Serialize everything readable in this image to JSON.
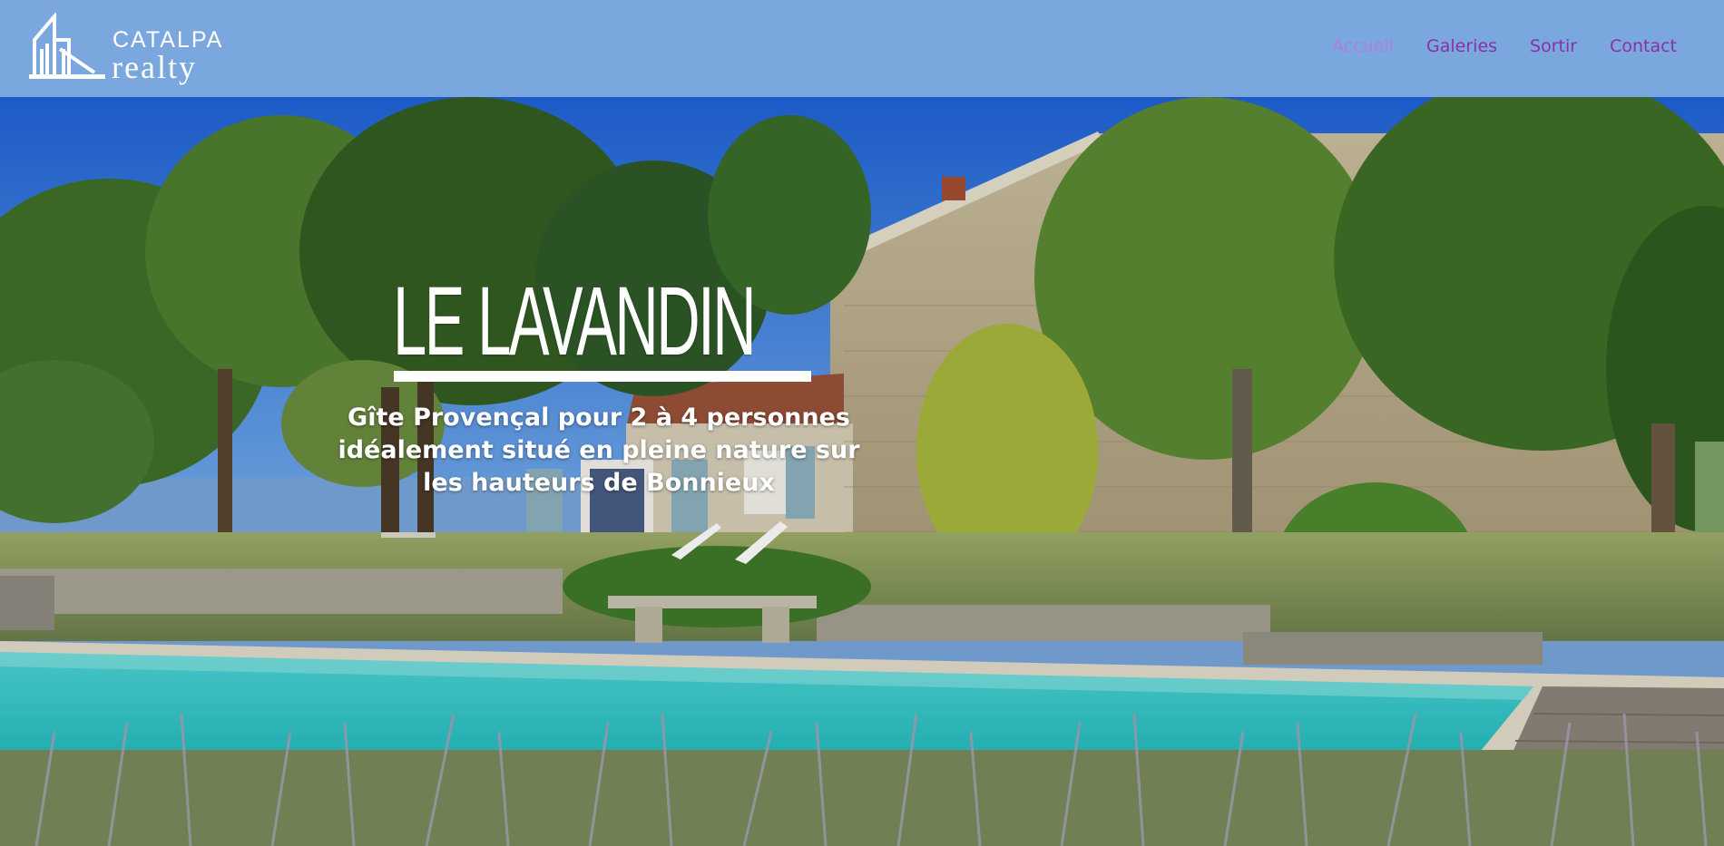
{
  "brand": {
    "name_top": "CATALPA",
    "name_bottom": "realty",
    "logo_icon": "building-outline-icon"
  },
  "nav": {
    "items": [
      {
        "label": "Accueil",
        "active": true
      },
      {
        "label": "Galeries",
        "active": false
      },
      {
        "label": "Sortir",
        "active": false
      },
      {
        "label": "Contact",
        "active": false
      }
    ]
  },
  "hero": {
    "title": "LE LAVANDIN",
    "subtitle": "Gîte Provençal pour 2 à 4 personnes idéalement situé en pleine nature sur les hauteurs de Bonnieux"
  },
  "colors": {
    "header_bg": "#7aa8de",
    "nav_link": "#8b2fa8",
    "nav_active": "#b27ce0",
    "title_text": "#ffffff"
  }
}
